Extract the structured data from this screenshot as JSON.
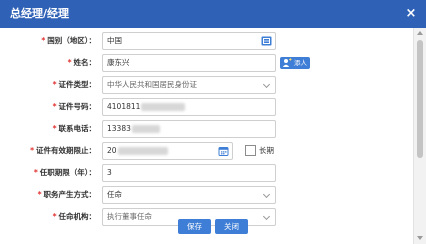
{
  "dialog": {
    "title": "总经理/经理",
    "close_glyph": "×"
  },
  "form": {
    "country_label": "国别（地区）：",
    "country_value": "中国",
    "name_label": "姓名：",
    "name_value": "康东兴",
    "name_badge": "添人",
    "id_type_label": "证件类型：",
    "id_type_value": "中华人民共和国居民身份证",
    "id_number_label": "证件号码：",
    "id_number_value": "4101811",
    "phone_label": "联系电话：",
    "phone_value": "13383",
    "validity_label": "证件有效期限止：",
    "validity_value": "20",
    "validity_longterm_label": "长期",
    "term_label": "任职期限（年）：",
    "term_value": "3",
    "appoint_method_label": "职务产生方式：",
    "appoint_method_value": "任命",
    "appoint_body_label": "任命机构：",
    "appoint_body_value": "执行董事任命",
    "required_mark": "*"
  },
  "footer": {
    "save_label": "保存",
    "close_label": "关闭"
  },
  "icons": {
    "country_picker": "globe-picker-icon",
    "calendar": "calendar-icon",
    "dropdown": "chevron-down-icon",
    "badge": "person-add-icon"
  },
  "colors": {
    "titlebar": "#2f61b6",
    "button": "#3f7ed6",
    "required": "#e0312f"
  }
}
